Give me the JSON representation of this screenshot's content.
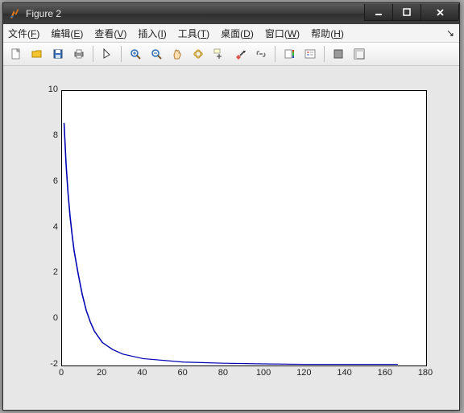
{
  "window": {
    "title": "Figure 2"
  },
  "menu": {
    "file": {
      "label": "文件",
      "accel": "F"
    },
    "edit": {
      "label": "编辑",
      "accel": "E"
    },
    "view": {
      "label": "查看",
      "accel": "V"
    },
    "insert": {
      "label": "插入",
      "accel": "I"
    },
    "tools": {
      "label": "工具",
      "accel": "T"
    },
    "desktop": {
      "label": "桌面",
      "accel": "D"
    },
    "window": {
      "label": "窗口",
      "accel": "W"
    },
    "help": {
      "label": "帮助",
      "accel": "H"
    }
  },
  "toolbar": {
    "new": "New Figure",
    "open": "Open",
    "save": "Save",
    "print": "Print",
    "edit": "Edit Plot",
    "zoomin": "Zoom In",
    "zoomout": "Zoom Out",
    "pan": "Pan",
    "rotate": "Rotate 3D",
    "datacursor": "Data Cursor",
    "brush": "Brush",
    "link": "Link Plot",
    "colorbar": "Insert Colorbar",
    "legend": "Insert Legend",
    "hide": "Hide Plot Tools",
    "show": "Show Plot Tools"
  },
  "chart_data": {
    "type": "line",
    "xlabel": "",
    "ylabel": "",
    "xlim": [
      0,
      180
    ],
    "ylim": [
      -2,
      10
    ],
    "xticks": [
      0,
      20,
      40,
      60,
      80,
      100,
      120,
      140,
      160,
      180
    ],
    "yticks": [
      -2,
      0,
      2,
      4,
      6,
      8,
      10
    ],
    "series": [
      {
        "name": "",
        "color": "#0000b3",
        "x": [
          1,
          2,
          3,
          4,
          5,
          6,
          8,
          10,
          12,
          14,
          16,
          20,
          25,
          30,
          40,
          60,
          80,
          100,
          120,
          140,
          160,
          166
        ],
        "values": [
          8.6,
          6.8,
          5.5,
          4.5,
          3.7,
          3.0,
          2.0,
          1.1,
          0.4,
          -0.1,
          -0.5,
          -1.0,
          -1.3,
          -1.5,
          -1.7,
          -1.85,
          -1.9,
          -1.93,
          -1.95,
          -1.95,
          -1.95,
          -1.95
        ]
      }
    ]
  }
}
